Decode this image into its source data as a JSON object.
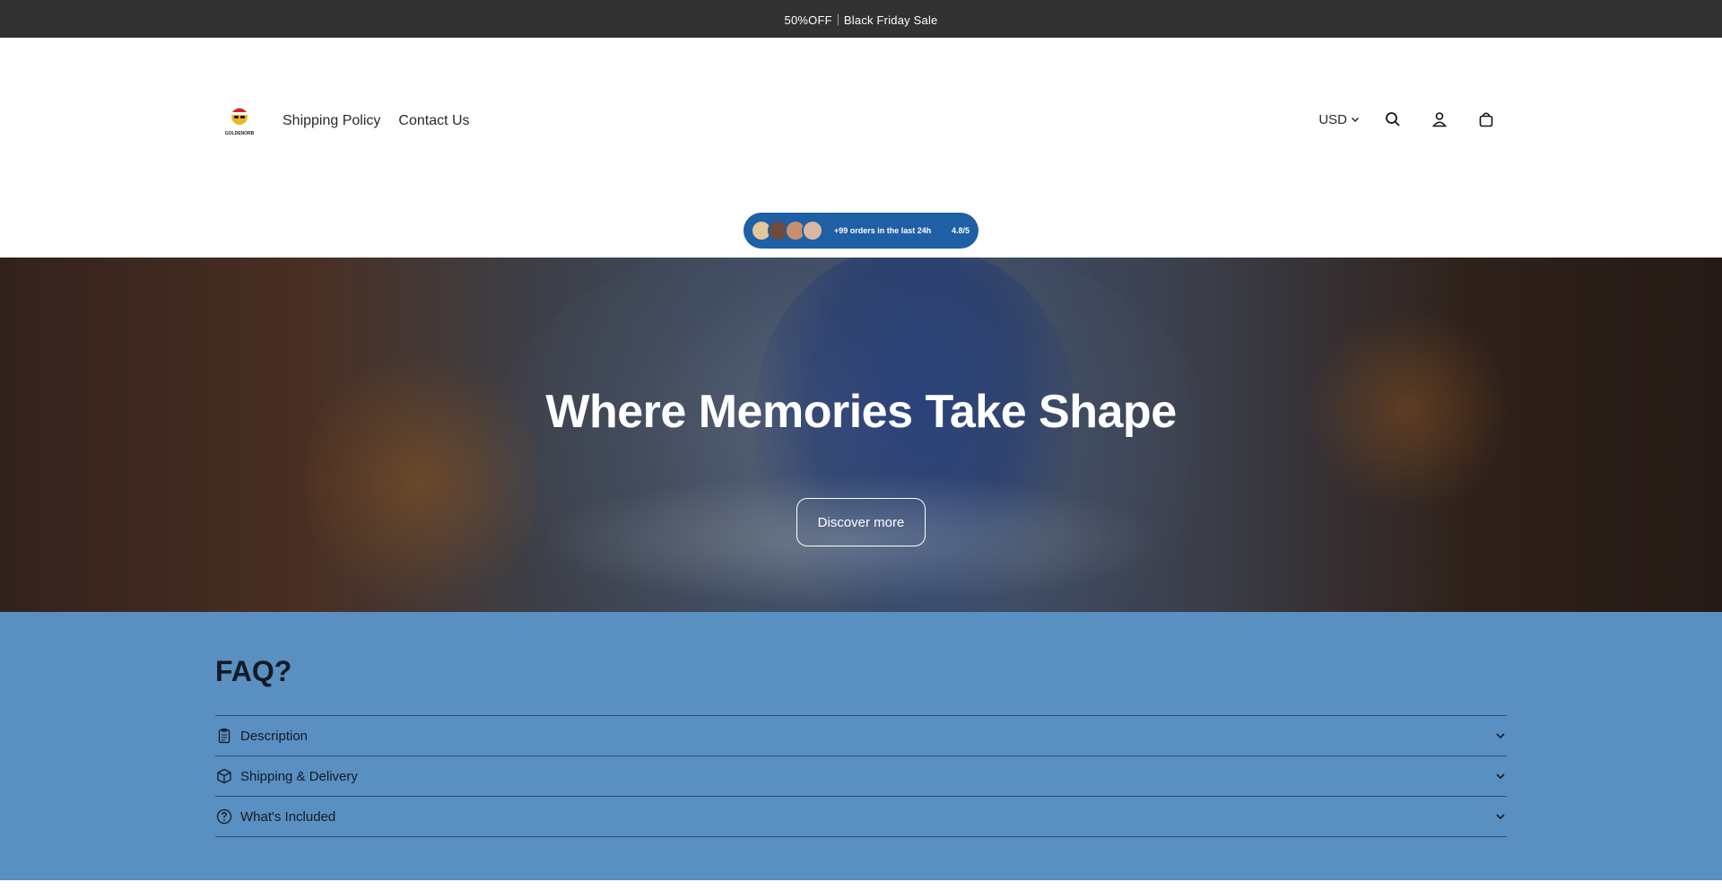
{
  "announcement": {
    "text": "50%OFF｜Black Friday Sale"
  },
  "header": {
    "logo_text": "GOLDENORB",
    "nav": [
      {
        "label": "Shipping Policy"
      },
      {
        "label": "Contact Us"
      }
    ],
    "currency": "USD",
    "icons": [
      "search-icon",
      "account-icon",
      "cart-icon"
    ]
  },
  "badge": {
    "text": "+99 orders in the last 24h",
    "rating": "4.8/5"
  },
  "hero": {
    "title": "Where Memories Take Shape",
    "button_label": "Discover more"
  },
  "faq": {
    "title": "FAQ?",
    "items": [
      {
        "label": "Description",
        "icon": "clipboard-icon"
      },
      {
        "label": "Shipping & Delivery",
        "icon": "box-icon"
      },
      {
        "label": "What's Included",
        "icon": "question-circle-icon"
      }
    ]
  },
  "colors": {
    "announcement_bg": "#323232",
    "badge_bg": "#1f5fa6",
    "faq_bg": "#5a8fc2"
  }
}
